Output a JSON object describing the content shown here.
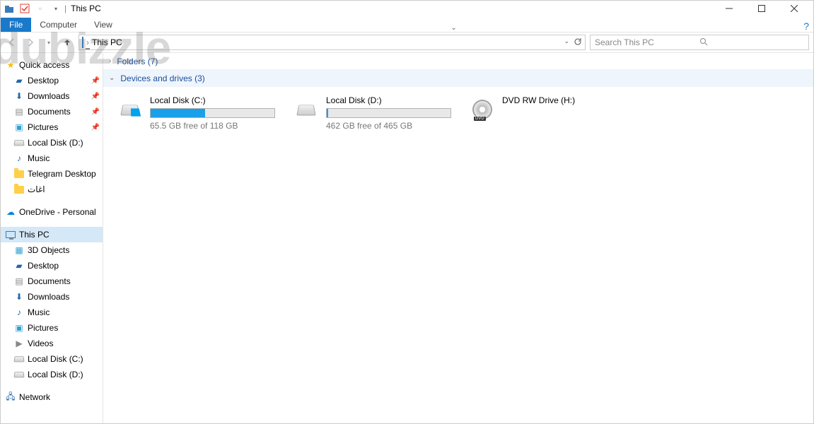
{
  "title": "This PC",
  "ribbon": {
    "file": "File",
    "computer": "Computer",
    "view": "View"
  },
  "breadcrumb": [
    "This PC"
  ],
  "search_placeholder": "Search This PC",
  "sidebar": {
    "quick_access": "Quick access",
    "items_qa": [
      {
        "label": "Desktop",
        "pinned": true,
        "icon": "desktop"
      },
      {
        "label": "Downloads",
        "pinned": true,
        "icon": "downloads"
      },
      {
        "label": "Documents",
        "pinned": true,
        "icon": "documents"
      },
      {
        "label": "Pictures",
        "pinned": true,
        "icon": "pictures"
      },
      {
        "label": "Local Disk (D:)",
        "pinned": false,
        "icon": "disk"
      },
      {
        "label": "Music",
        "pinned": false,
        "icon": "music"
      },
      {
        "label": "Telegram Desktop",
        "pinned": false,
        "icon": "folder"
      },
      {
        "label": "اغات",
        "pinned": false,
        "icon": "folder"
      }
    ],
    "onedrive": "OneDrive - Personal",
    "this_pc": "This PC",
    "items_pc": [
      {
        "label": "3D Objects"
      },
      {
        "label": "Desktop"
      },
      {
        "label": "Documents"
      },
      {
        "label": "Downloads"
      },
      {
        "label": "Music"
      },
      {
        "label": "Pictures"
      },
      {
        "label": "Videos"
      },
      {
        "label": "Local Disk (C:)"
      },
      {
        "label": "Local Disk (D:)"
      }
    ],
    "network": "Network"
  },
  "groups": {
    "folders": "Folders (7)",
    "devices": "Devices and drives (3)"
  },
  "drives": [
    {
      "name": "Local Disk (C:)",
      "sub": "65.5 GB free of 118 GB",
      "fill_pct": 44,
      "kind": "win-disk"
    },
    {
      "name": "Local Disk (D:)",
      "sub": "462 GB free of 465 GB",
      "fill_pct": 1,
      "kind": "disk"
    },
    {
      "name": "DVD RW Drive (H:)",
      "sub": "",
      "fill_pct": null,
      "kind": "dvd"
    }
  ],
  "watermark": "dubizzle"
}
